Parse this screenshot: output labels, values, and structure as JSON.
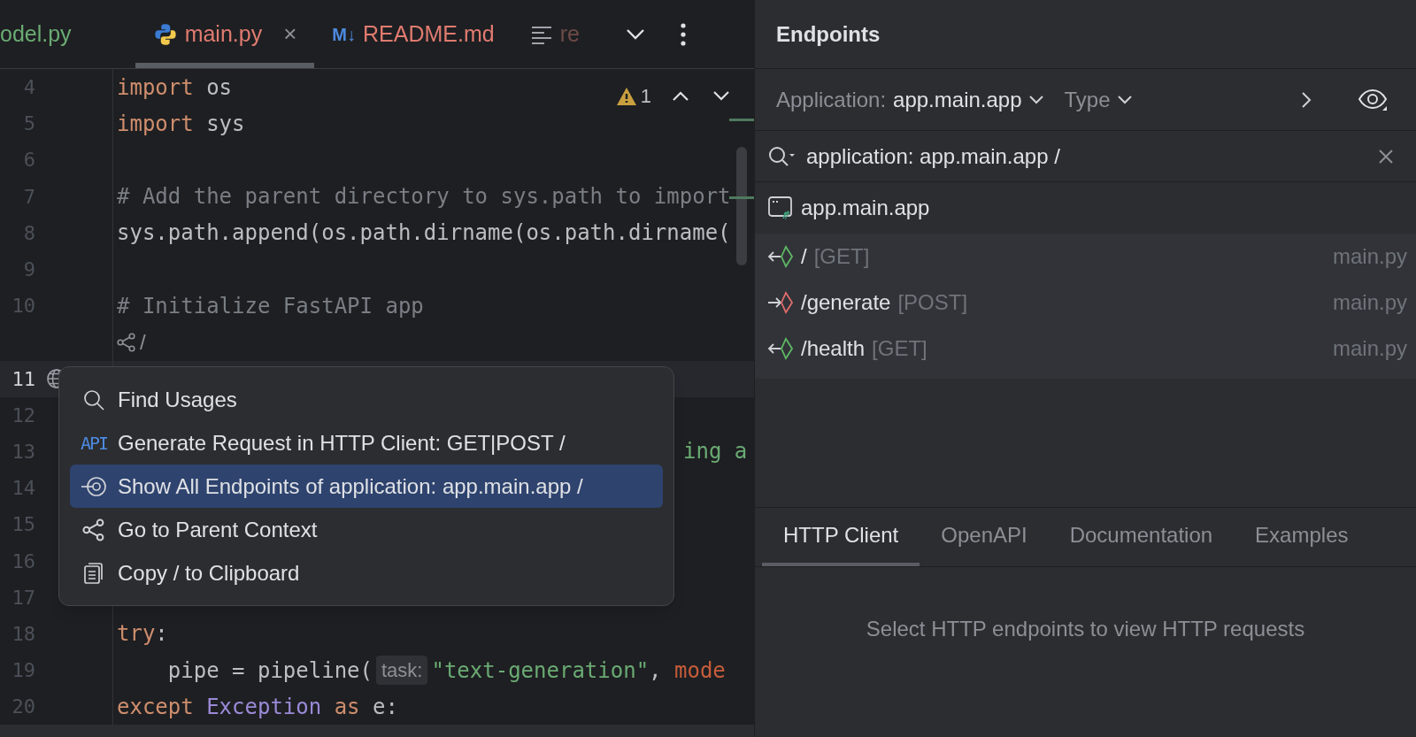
{
  "editor": {
    "tabs": [
      {
        "label": "odel.py",
        "kind": "plain",
        "selected": false
      },
      {
        "label": "main.py",
        "kind": "python",
        "selected": true,
        "close": "×"
      },
      {
        "label": "README.md",
        "kind": "markdown",
        "badge": "M↓",
        "selected": false
      },
      {
        "label": "re",
        "kind": "faded",
        "selected": false
      }
    ],
    "warnings": "1",
    "lines": [
      {
        "number": "4",
        "tokens": [
          {
            "text": "import",
            "kind": "keyword"
          },
          {
            "text": " os",
            "kind": "plain"
          }
        ]
      },
      {
        "number": "5",
        "tokens": [
          {
            "text": "import",
            "kind": "keyword"
          },
          {
            "text": " sys",
            "kind": "plain"
          }
        ]
      },
      {
        "number": "6"
      },
      {
        "number": "7",
        "tokens": [
          {
            "text": "# Add the parent directory to sys.path to import",
            "kind": "comment"
          }
        ]
      },
      {
        "number": "8",
        "tokens": [
          {
            "text": "sys.path.append(os.path.dirname(os.path.dirname(",
            "kind": "plain"
          }
        ]
      },
      {
        "number": "9"
      },
      {
        "number": "10",
        "tokens": [
          {
            "text": "# Initialize FastAPI app",
            "kind": "comment"
          }
        ]
      },
      {
        "inlay": "/"
      },
      {
        "number": "11",
        "current": true
      },
      {
        "number": "12",
        "current": false
      },
      {
        "number": "13",
        "tokens": [
          {
            "text": "ing a",
            "kind": "string_tail"
          }
        ]
      },
      {
        "number": "14"
      },
      {
        "number": "15"
      },
      {
        "number": "16"
      },
      {
        "number": "17"
      },
      {
        "number": "18",
        "tokens": [
          {
            "text": "try",
            "kind": "keyword"
          },
          {
            "text": ":",
            "kind": "plain"
          }
        ]
      },
      {
        "number": "19",
        "tokens": [
          {
            "text": "    pipe = pipeline(",
            "kind": "plain"
          },
          {
            "text": "task:",
            "kind": "hint"
          },
          {
            "text": "\"text-generation\"",
            "kind": "string"
          },
          {
            "text": ", ",
            "kind": "plain"
          },
          {
            "text": "mode",
            "kind": "param"
          }
        ]
      },
      {
        "number": "20",
        "tokens": [
          {
            "text": "except",
            "kind": "keyword"
          },
          {
            "text": " Exception",
            "kind": "class"
          },
          {
            "text": " as",
            "kind": "keyword"
          },
          {
            "text": " e:",
            "kind": "plain"
          }
        ]
      }
    ]
  },
  "popup": {
    "items": [
      {
        "label": "Find Usages",
        "kind": "search",
        "selected": false
      },
      {
        "label": "Generate Request in HTTP Client: GET|POST /",
        "kind": "api",
        "icon_text": "API",
        "selected": false
      },
      {
        "label": "Show All Endpoints of application: app.main.app /",
        "kind": "endpoint",
        "selected": true
      },
      {
        "label": "Go to Parent Context",
        "kind": "share",
        "selected": false
      },
      {
        "label": "Copy / to Clipboard",
        "kind": "copy",
        "selected": false
      }
    ]
  },
  "endpoints": {
    "title": "Endpoints",
    "filter": {
      "label": "Application:",
      "value": "app.main.app",
      "type": "Type"
    },
    "search": "application: app.main.app /",
    "group": "app.main.app",
    "rows": [
      {
        "path": "/",
        "method": "[GET]",
        "kind": "get",
        "file": "main.py"
      },
      {
        "path": "/generate",
        "method": "[POST]",
        "kind": "post",
        "file": "main.py"
      },
      {
        "path": "/health",
        "method": "[GET]",
        "kind": "get",
        "file": "main.py"
      }
    ],
    "tabs": [
      {
        "label": "HTTP Client",
        "selected": true
      },
      {
        "label": "OpenAPI",
        "selected": false
      },
      {
        "label": "Documentation",
        "selected": false
      },
      {
        "label": "Examples",
        "selected": false
      }
    ],
    "empty": "Select HTTP endpoints to view HTTP requests"
  }
}
